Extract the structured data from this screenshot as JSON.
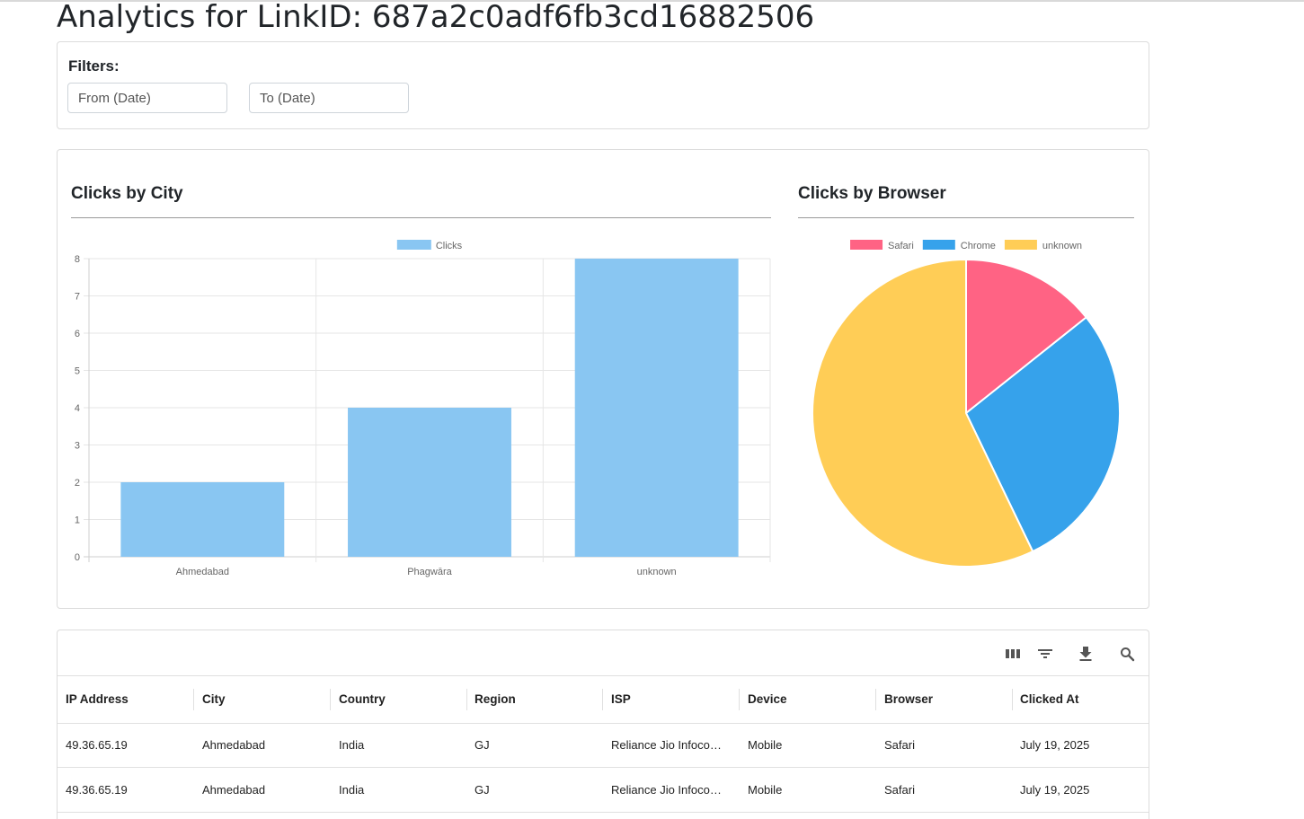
{
  "page": {
    "title": "Analytics for LinkID: 687a2c0adf6fb3cd16882506"
  },
  "filters": {
    "label": "Filters:",
    "from_placeholder": "From (Date)",
    "to_placeholder": "To (Date)"
  },
  "city_chart": {
    "title": "Clicks by City"
  },
  "browser_chart": {
    "title": "Clicks by Browser"
  },
  "chart_data": [
    {
      "type": "bar",
      "title": "Clicks by City",
      "categories": [
        "Ahmedabad",
        "Phagwāra",
        "unknown"
      ],
      "series": [
        {
          "name": "Clicks",
          "values": [
            2,
            4,
            8
          ],
          "color": "#89c6f2"
        }
      ],
      "ylim": [
        0,
        8
      ],
      "yticks": [
        0,
        1,
        2,
        3,
        4,
        5,
        6,
        7,
        8
      ],
      "grid": true,
      "legend": "top"
    },
    {
      "type": "pie",
      "title": "Clicks by Browser",
      "labels": [
        "Safari",
        "Chrome",
        "unknown"
      ],
      "values": [
        2,
        4,
        8
      ],
      "colors": [
        "#ff6384",
        "#36a2eb",
        "#ffcd56"
      ],
      "legend": "top"
    }
  ],
  "table": {
    "toolbar_icons": [
      "view-columns-icon",
      "filter-icon",
      "download-icon",
      "search-icon"
    ],
    "columns": [
      "IP Address",
      "City",
      "Country",
      "Region",
      "ISP",
      "Device",
      "Browser",
      "Clicked At"
    ],
    "rows": [
      [
        "49.36.65.19",
        "Ahmedabad",
        "India",
        "GJ",
        "Reliance Jio Infocomm Limited",
        "Mobile",
        "Safari",
        "July 19, 2025"
      ],
      [
        "49.36.65.19",
        "Ahmedabad",
        "India",
        "GJ",
        "Reliance Jio Infocomm Limited",
        "Mobile",
        "Safari",
        "July 19, 2025"
      ]
    ]
  }
}
